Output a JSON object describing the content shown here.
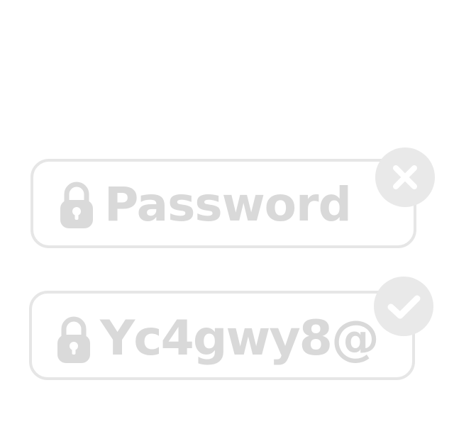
{
  "fields": [
    {
      "state": "invalid",
      "value": "Password",
      "leading_icon": "lock-icon",
      "status_icon": "close-icon"
    },
    {
      "state": "valid",
      "value": "Yc4gwy8@",
      "leading_icon": "lock-icon",
      "status_icon": "check-icon"
    }
  ],
  "colors": {
    "border": "#e6e6e6",
    "text": "#d9d9d9",
    "icon": "#dadada",
    "badge": "#e9e9e9",
    "badge_glyph": "#ffffff"
  }
}
